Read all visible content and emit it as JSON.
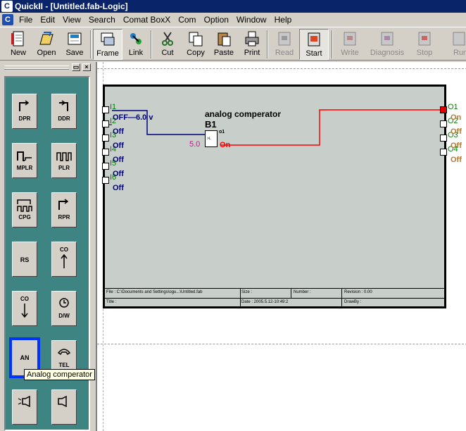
{
  "window": {
    "title": "QuickII - [Untitled.fab-Logic]"
  },
  "menu": [
    "File",
    "Edit",
    "View",
    "Search",
    "Comat BoxX",
    "Com",
    "Option",
    "Window",
    "Help"
  ],
  "toolbar": {
    "new": "New",
    "open": "Open",
    "save": "Save",
    "frame": "Frame",
    "link": "Link",
    "cut": "Cut",
    "copy": "Copy",
    "paste": "Paste",
    "print": "Print",
    "read": "Read",
    "start": "Start",
    "write": "Write",
    "diagnosis": "Diagnosis",
    "stop": "Stop",
    "run": "Run"
  },
  "palette": {
    "dpr": "DPR",
    "ddr": "DDR",
    "mplr": "MPLR",
    "plr": "PLR",
    "cpg": "CPG",
    "rpr": "RPR",
    "rs": "RS",
    "cu": "CO",
    "cd": "CO",
    "dw": "D/W",
    "an": "AN",
    "tel": "TEL",
    "tooltip": "Analog comperator"
  },
  "diagram": {
    "inputs": [
      "I1",
      "I2",
      "I3",
      "I4",
      "I5",
      "I6"
    ],
    "input_values": [
      "OFF—6.0 v",
      "Off",
      "Off",
      "Off",
      "Off",
      "Off"
    ],
    "outputs": [
      "O1",
      "O2",
      "O3",
      "O4"
    ],
    "output_values": [
      "On",
      "Off",
      "Off",
      "Off"
    ],
    "block_title": "analog comperator",
    "block_id": "B1",
    "block_pin_out": "o1",
    "block_inner": ">L",
    "threshold": "5.0",
    "block_state": "On",
    "info": {
      "file": "File : C:\\Documents and Settings\\ogu...\\Untitled.fab",
      "size": "Size :",
      "number": "Number :",
      "revision": "Revision : 0.00",
      "title": "Title :",
      "date": "Date : 2005.5.12-10:49:2",
      "drawby": "DrawBy :"
    }
  }
}
